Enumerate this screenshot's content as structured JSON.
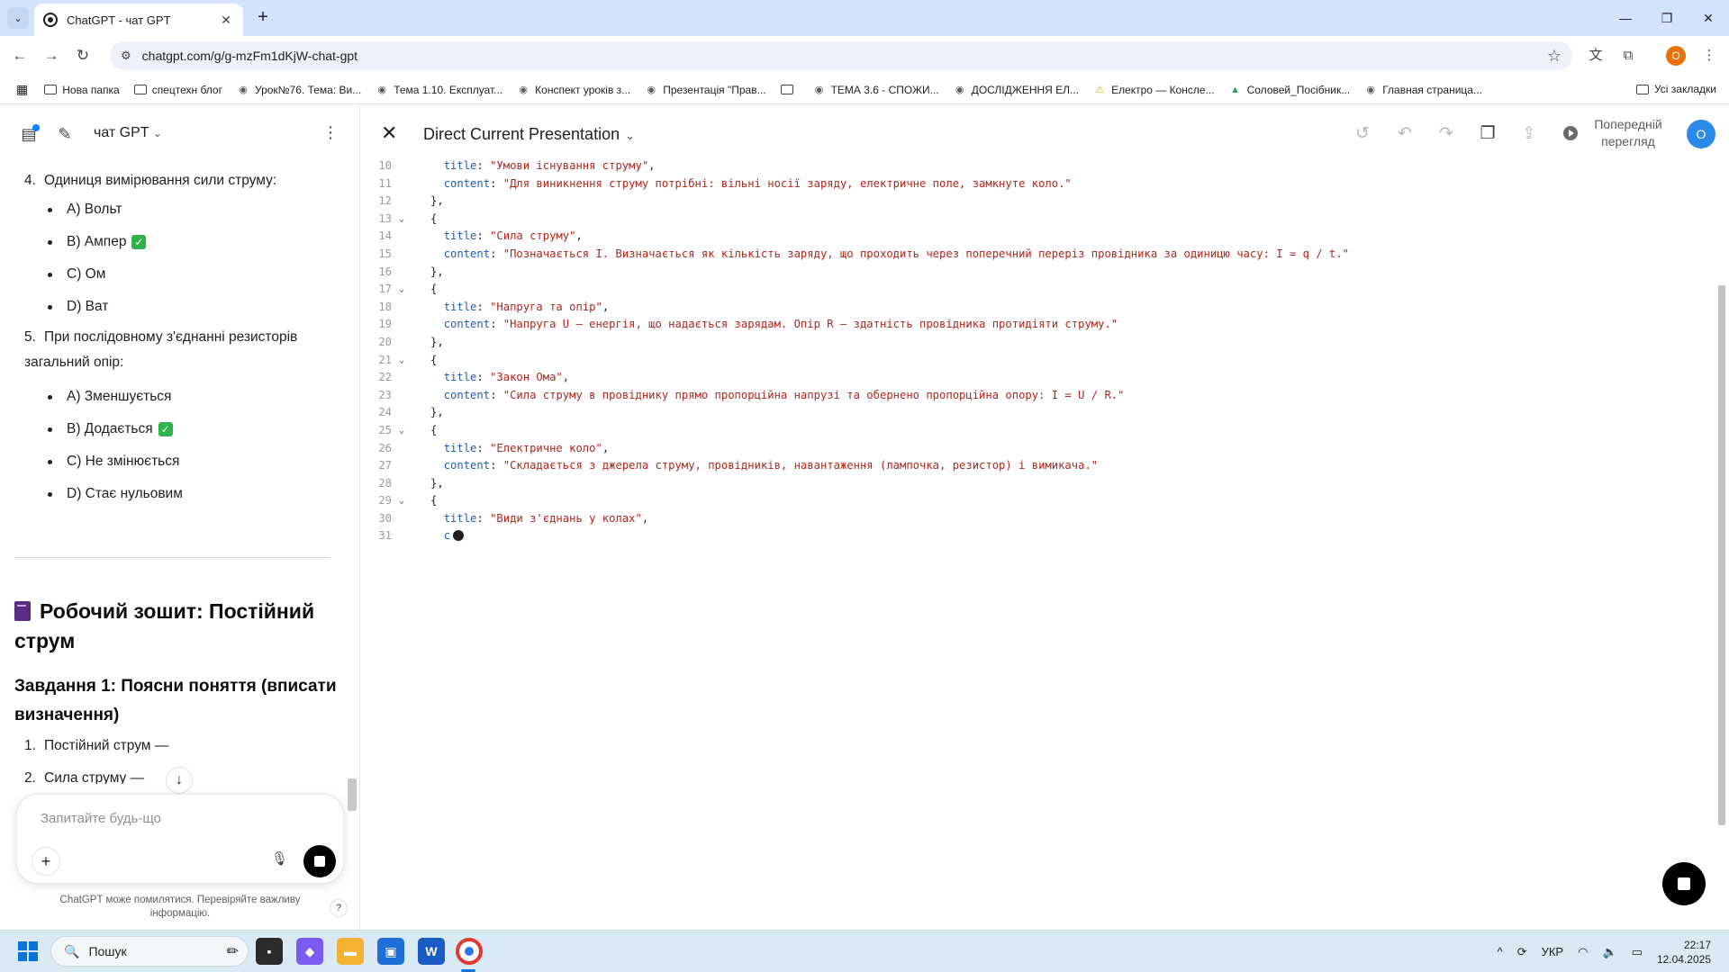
{
  "browser": {
    "tab_title": "ChatGPT - чат GPT",
    "url": "chatgpt.com/g/g-mzFm1dKjW-chat-gpt",
    "profile_initial": "O",
    "bookmarks": [
      {
        "label": "Нова папка",
        "icon": "folder"
      },
      {
        "label": "спецтехн блог",
        "icon": "folder"
      },
      {
        "label": "Урок№76. Тема: Ви...",
        "icon": "site"
      },
      {
        "label": "Тема 1.10. Експлуат...",
        "icon": "site"
      },
      {
        "label": "Конспект уроків з...",
        "icon": "site"
      },
      {
        "label": "Презентація \"Прав...",
        "icon": "site"
      },
      {
        "label": "",
        "icon": "folder"
      },
      {
        "label": "ТЕМА 3.6 - СПОЖИ...",
        "icon": "site"
      },
      {
        "label": "ДОСЛІДЖЕННЯ ЕЛ...",
        "icon": "site"
      },
      {
        "label": "Електро — Консле...",
        "icon": "warning"
      },
      {
        "label": "Соловей_Посібник...",
        "icon": "drive"
      },
      {
        "label": "Главная страница...",
        "icon": "site"
      }
    ],
    "all_bookmarks": "Усі закладки"
  },
  "sidebar": {
    "title": "чат GPT",
    "questions": [
      {
        "number": "4.",
        "text": "Одиниця вимірювання сили струму:",
        "options": [
          {
            "text": "A) Вольт",
            "correct": false
          },
          {
            "text": "B) Ампер",
            "correct": true
          },
          {
            "text": "C) Ом",
            "correct": false
          },
          {
            "text": "D) Ват",
            "correct": false
          }
        ]
      },
      {
        "number": "5.",
        "text": "При послідовному з'єднанні резисторів загальний опір:",
        "options": [
          {
            "text": "A) Зменшується",
            "correct": false
          },
          {
            "text": "B) Додається",
            "correct": true
          },
          {
            "text": "C) Не змінюється",
            "correct": false
          },
          {
            "text": "D) Стає нульовим",
            "correct": false
          }
        ]
      }
    ],
    "workbook_title": "Робочий зошит: Постійний струм",
    "task_title": "Завдання 1: Поясни поняття (вписати визначення)",
    "task_items": [
      {
        "number": "1.",
        "text": "Постійний струм —"
      },
      {
        "number": "2.",
        "text": "Сила струму —"
      }
    ],
    "composer_placeholder": "Запитайте будь-що",
    "disclaimer": "ChatGPT може помилятися. Перевіряйте важливу інформацію.",
    "help": "?"
  },
  "canvas": {
    "title": "Direct Current Presentation",
    "preview_label": "Попередній перегляд",
    "avatar_initial": "O",
    "code_lines": [
      {
        "n": "10",
        "fold": false,
        "indent": "  ",
        "key": "title",
        "value": "\"Умови існування струму\"",
        "tail": ","
      },
      {
        "n": "11",
        "fold": false,
        "indent": "  ",
        "key": "content",
        "value": "\"Для виникнення струму потрібні: вільні носії заряду, електричне поле, замкнуте коло.\"",
        "tail": ""
      },
      {
        "n": "12",
        "fold": false,
        "indent": "",
        "plain": "},"
      },
      {
        "n": "13",
        "fold": true,
        "indent": "",
        "plain": "{"
      },
      {
        "n": "14",
        "fold": false,
        "indent": "  ",
        "key": "title",
        "value": "\"Сила струму\"",
        "tail": ","
      },
      {
        "n": "15",
        "fold": false,
        "indent": "  ",
        "key": "content",
        "value": "\"Позначається I. Визначається як кількість заряду, що проходить через поперечний переріз провідника за одиницю часу: I = q / t.\"",
        "tail": ""
      },
      {
        "n": "16",
        "fold": false,
        "indent": "",
        "plain": "},"
      },
      {
        "n": "17",
        "fold": true,
        "indent": "",
        "plain": "{"
      },
      {
        "n": "18",
        "fold": false,
        "indent": "  ",
        "key": "title",
        "value": "\"Напруга та опір\"",
        "tail": ","
      },
      {
        "n": "19",
        "fold": false,
        "indent": "  ",
        "key": "content",
        "value": "\"Напруга U — енергія, що надається зарядам. Опір R — здатність провідника протидіяти струму.\"",
        "tail": ""
      },
      {
        "n": "20",
        "fold": false,
        "indent": "",
        "plain": "},"
      },
      {
        "n": "21",
        "fold": true,
        "indent": "",
        "plain": "{"
      },
      {
        "n": "22",
        "fold": false,
        "indent": "  ",
        "key": "title",
        "value": "\"Закон Ома\"",
        "tail": ","
      },
      {
        "n": "23",
        "fold": false,
        "indent": "  ",
        "key": "content",
        "value": "\"Сила струму в провіднику прямо пропорційна напрузі та обернено пропорційна опору: I = U / R.\"",
        "tail": ""
      },
      {
        "n": "24",
        "fold": false,
        "indent": "",
        "plain": "},"
      },
      {
        "n": "25",
        "fold": true,
        "indent": "",
        "plain": "{"
      },
      {
        "n": "26",
        "fold": false,
        "indent": "  ",
        "key": "title",
        "value": "\"Електричне коло\"",
        "tail": ","
      },
      {
        "n": "27",
        "fold": false,
        "indent": "  ",
        "key": "content",
        "value": "\"Складається з джерела струму, провідників, навантаження (лампочка, резистор) і вимикача.\"",
        "tail": ""
      },
      {
        "n": "28",
        "fold": false,
        "indent": "",
        "plain": "},"
      },
      {
        "n": "29",
        "fold": true,
        "indent": "",
        "plain": "{"
      },
      {
        "n": "30",
        "fold": false,
        "indent": "  ",
        "key": "title",
        "value": "\"Види з'єднань у колах\"",
        "tail": ","
      },
      {
        "n": "31",
        "fold": false,
        "indent": "  ",
        "partial": "c",
        "cursor": true
      }
    ]
  },
  "taskbar": {
    "search_label": "Пошук",
    "language": "УКР",
    "time": "22:17",
    "date": "12.04.2025"
  },
  "colors": {
    "code_key": "#1a5fb4",
    "code_string": "#b0271d",
    "check_green": "#2fb24a",
    "accent_blue": "#2b8ae8"
  }
}
